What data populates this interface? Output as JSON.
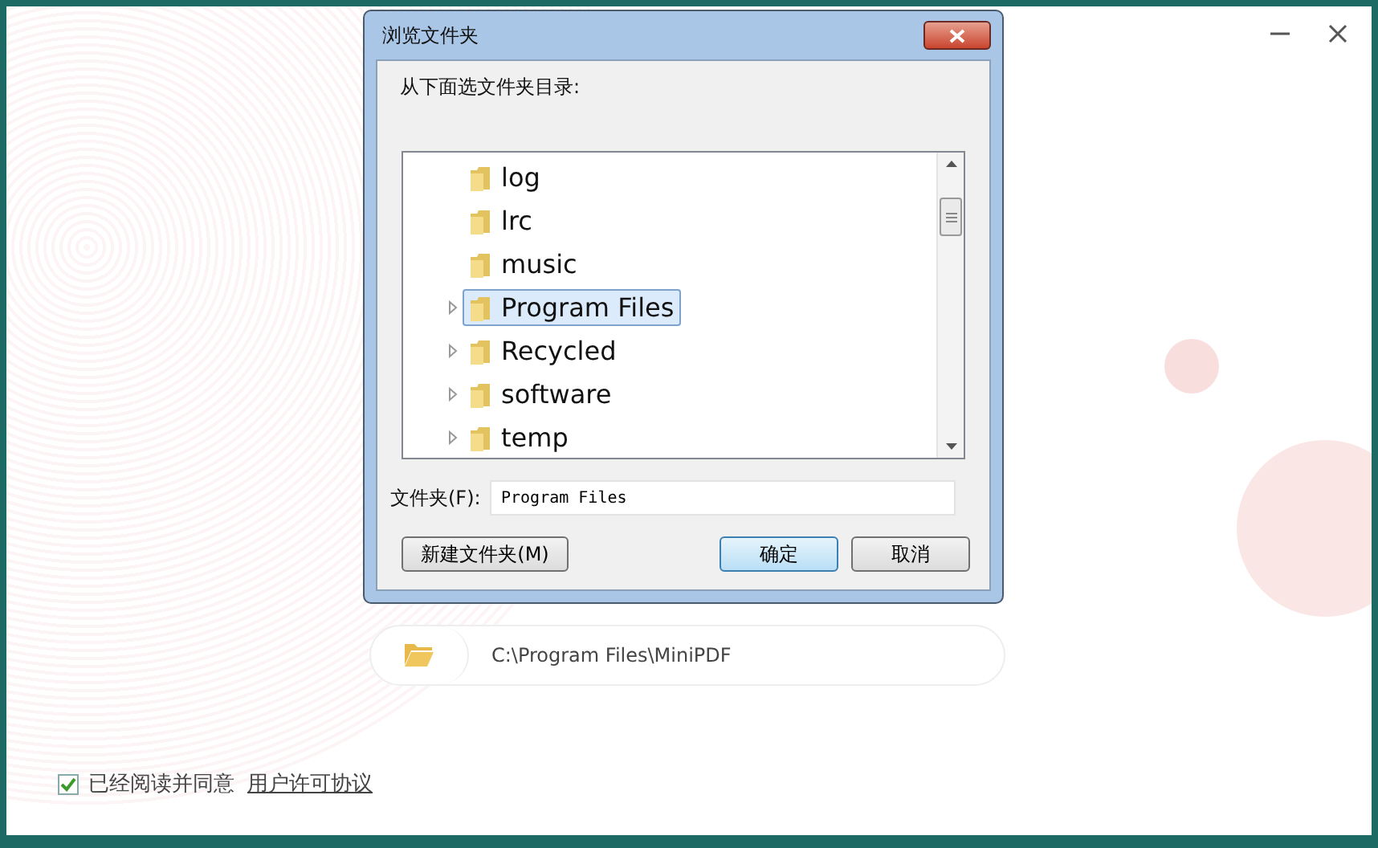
{
  "dialog": {
    "title": "浏览文件夹",
    "prompt": "从下面选文件夹目录:",
    "tree": [
      {
        "label": "log",
        "expandable": false,
        "selected": false
      },
      {
        "label": "lrc",
        "expandable": false,
        "selected": false
      },
      {
        "label": "music",
        "expandable": false,
        "selected": false
      },
      {
        "label": "Program Files",
        "expandable": true,
        "selected": true
      },
      {
        "label": "Recycled",
        "expandable": true,
        "selected": false
      },
      {
        "label": "software",
        "expandable": true,
        "selected": false
      },
      {
        "label": "temp",
        "expandable": true,
        "selected": false
      }
    ],
    "folder_field": {
      "label": "文件夹(F):",
      "value": "Program Files"
    },
    "buttons": [
      {
        "label": "新建文件夹(M)",
        "default": false
      },
      {
        "label": "确定",
        "default": true
      },
      {
        "label": "取消",
        "default": false
      }
    ]
  },
  "path_bar": {
    "path": "C:\\Program Files\\MiniPDF"
  },
  "agreement": {
    "checked": true,
    "text": "已经阅读并同意",
    "link": "用户许可协议"
  }
}
